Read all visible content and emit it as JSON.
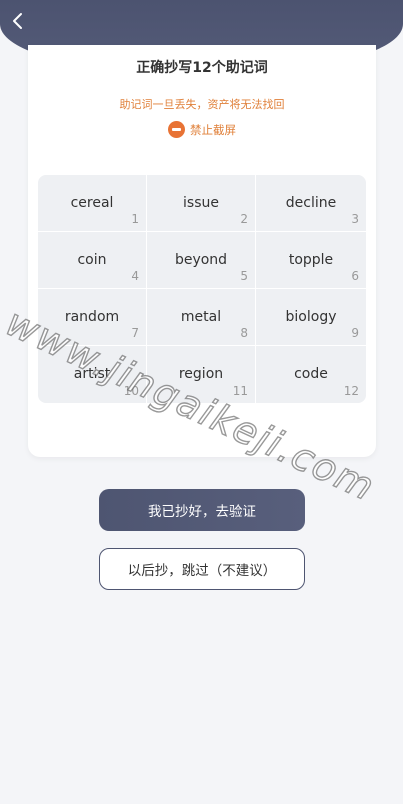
{
  "header": {
    "back_icon": "chevron-left-icon",
    "bg_color": "#4c5370"
  },
  "card": {
    "title": "正确抄写12个助记词",
    "warning": "助记词一旦丢失，资产将无法找回",
    "no_screenshot_label": "禁止截屏",
    "no_screenshot_icon": "ban-icon",
    "accent_color": "#e87335"
  },
  "mnemonic": [
    {
      "word": "cereal",
      "index": "1"
    },
    {
      "word": "issue",
      "index": "2"
    },
    {
      "word": "decline",
      "index": "3"
    },
    {
      "word": "coin",
      "index": "4"
    },
    {
      "word": "beyond",
      "index": "5"
    },
    {
      "word": "topple",
      "index": "6"
    },
    {
      "word": "random",
      "index": "7"
    },
    {
      "word": "metal",
      "index": "8"
    },
    {
      "word": "biology",
      "index": "9"
    },
    {
      "word": "artist",
      "index": "10"
    },
    {
      "word": "region",
      "index": "11"
    },
    {
      "word": "code",
      "index": "12"
    }
  ],
  "actions": {
    "verify_label": "我已抄好，去验证",
    "skip_label": "以后抄，跳过（不建议）"
  },
  "watermark": "www.jingaikeji.com"
}
